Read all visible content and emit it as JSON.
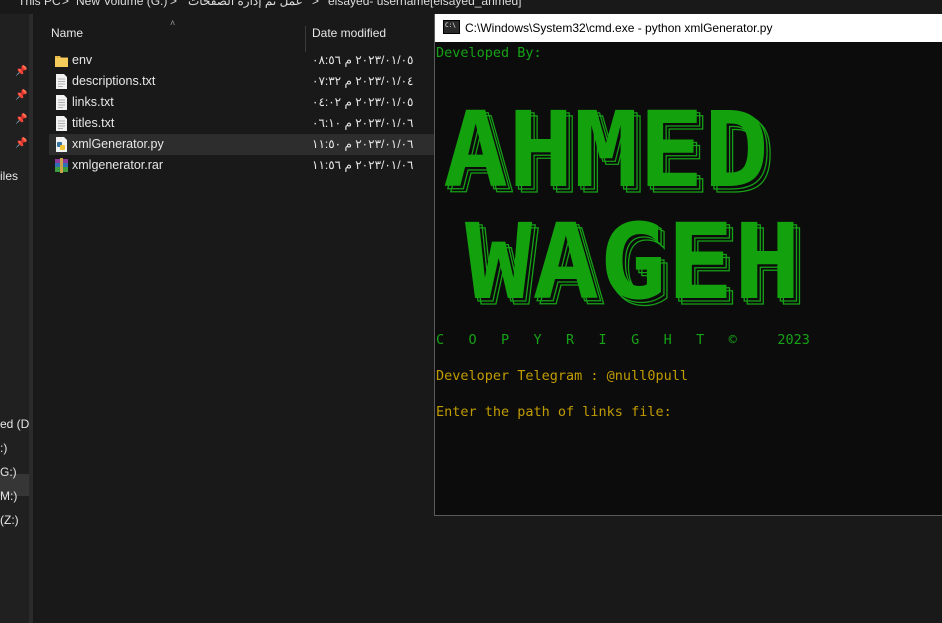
{
  "explorer": {
    "breadcrumb": [
      "This PC",
      ">",
      "New Volume (G:)",
      ">",
      "عمل ثم إدارة الصفحات",
      ">",
      "elsayed- username[elsayed_ahmed]"
    ],
    "columns": {
      "name": "Name",
      "date_modified": "Date modified"
    },
    "nav_labels": [
      "iles",
      "ed (D:)",
      ":)",
      "G:)",
      "M:)",
      "(Z:)"
    ],
    "files": [
      {
        "name": "env",
        "date": "٢٠٢٣/٠١/٠٥ م ٠٨:٥٦",
        "icon": "folder-icon"
      },
      {
        "name": "descriptions.txt",
        "date": "٢٠٢٣/٠١/٠٤ م ٠٧:٣٢",
        "icon": "text-file-icon"
      },
      {
        "name": "links.txt",
        "date": "٢٠٢٣/٠١/٠٥ م ٠٤:٠٢",
        "icon": "text-file-icon"
      },
      {
        "name": "titles.txt",
        "date": "٢٠٢٣/٠١/٠٦ م ٠٦:١٠",
        "icon": "text-file-icon"
      },
      {
        "name": "xmlGenerator.py",
        "date": "٢٠٢٣/٠١/٠٦ م ١١:٥٠",
        "icon": "python-file-icon"
      },
      {
        "name": "xmlgenerator.rar",
        "date": "٢٠٢٣/٠١/٠٦ م ١١:٥٦",
        "icon": "rar-archive-icon"
      }
    ],
    "selected_index": 4
  },
  "cmd": {
    "title": "C:\\Windows\\System32\\cmd.exe - python  xmlGenerator.py",
    "developed_by": "Developed By:",
    "banner_line1": "AHMED",
    "banner_line2": "WAGEH",
    "copyright": "C   O   P   Y   R   I   G   H   T   ©     2023",
    "telegram": "Developer Telegram : @null0pull",
    "prompt": "Enter the path of links file:",
    "colors": {
      "green": "#16a216",
      "yellow": "#c19c00",
      "bg": "#0c0c0c"
    }
  }
}
